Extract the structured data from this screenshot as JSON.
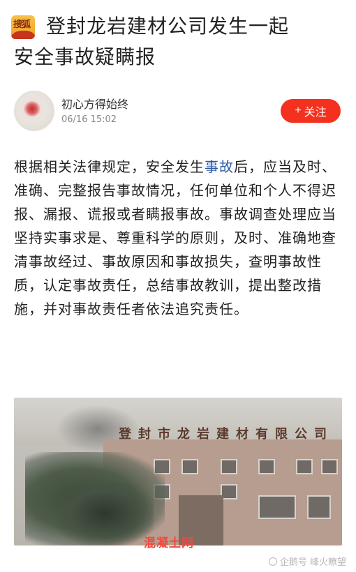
{
  "header": {
    "logo_text": "搜狐",
    "title_line1": "登封龙岩建材公司发生一起",
    "title_line2": "安全事故疑瞒报"
  },
  "author": {
    "name": "初心方得始终",
    "time": "06/16 15:02"
  },
  "follow_button": {
    "icon": "+",
    "label": "关注"
  },
  "article": {
    "text_before_link": "根据相关法律规定，安全发生",
    "link_text": "事故",
    "text_after_link": "后，应当及时、准确、完整报告事故情况，任何单位和个人不得迟报、漏报、谎报或者瞒报事故。事故调查处理应当坚持实事求是、尊重科学的原则，及时、准确地查清事故经过、事故原因和事故损失，查明事故性质，认定事故责任，总结事故教训，提出整改措施，并对事故责任者依法追究责任。"
  },
  "photo": {
    "sign_text": "登封市龙岩建材有限公司"
  },
  "watermarks": {
    "center": "混凝土网",
    "right": "企鹅号 峰火瞭望"
  },
  "colors": {
    "follow_button_bg": "#f4311e",
    "link": "#2a5ba8",
    "watermark_center": "#f2483b"
  }
}
